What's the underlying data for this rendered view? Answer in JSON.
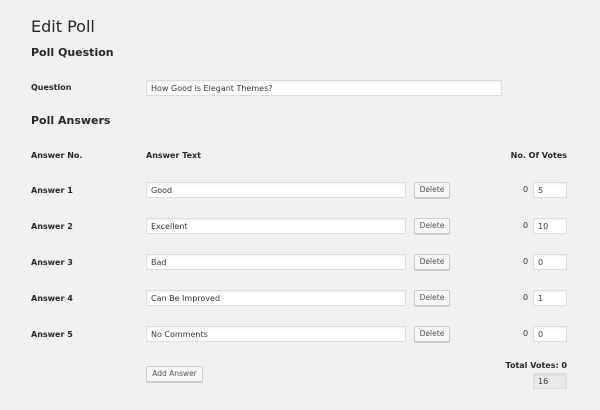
{
  "title": "Edit Poll",
  "question_section": {
    "heading": "Poll Question",
    "label": "Question",
    "value": "How Good is Elegant Themes?"
  },
  "answers_section": {
    "heading": "Poll Answers",
    "columns": {
      "no": "Answer No.",
      "text": "Answer Text",
      "votes": "No. Of Votes"
    },
    "delete_label": "Delete",
    "answers": [
      {
        "label": "Answer 1",
        "text": "Good",
        "count": "0",
        "votes": "5"
      },
      {
        "label": "Answer 2",
        "text": "Excellent",
        "count": "0",
        "votes": "10"
      },
      {
        "label": "Answer 3",
        "text": "Bad",
        "count": "0",
        "votes": "0"
      },
      {
        "label": "Answer 4",
        "text": "Can Be Improved",
        "count": "0",
        "votes": "1"
      },
      {
        "label": "Answer 5",
        "text": "No Comments",
        "count": "0",
        "votes": "0"
      }
    ],
    "add_answer_label": "Add Answer",
    "total_votes_label": "Total Votes: 0",
    "total_votes_value": "16"
  }
}
